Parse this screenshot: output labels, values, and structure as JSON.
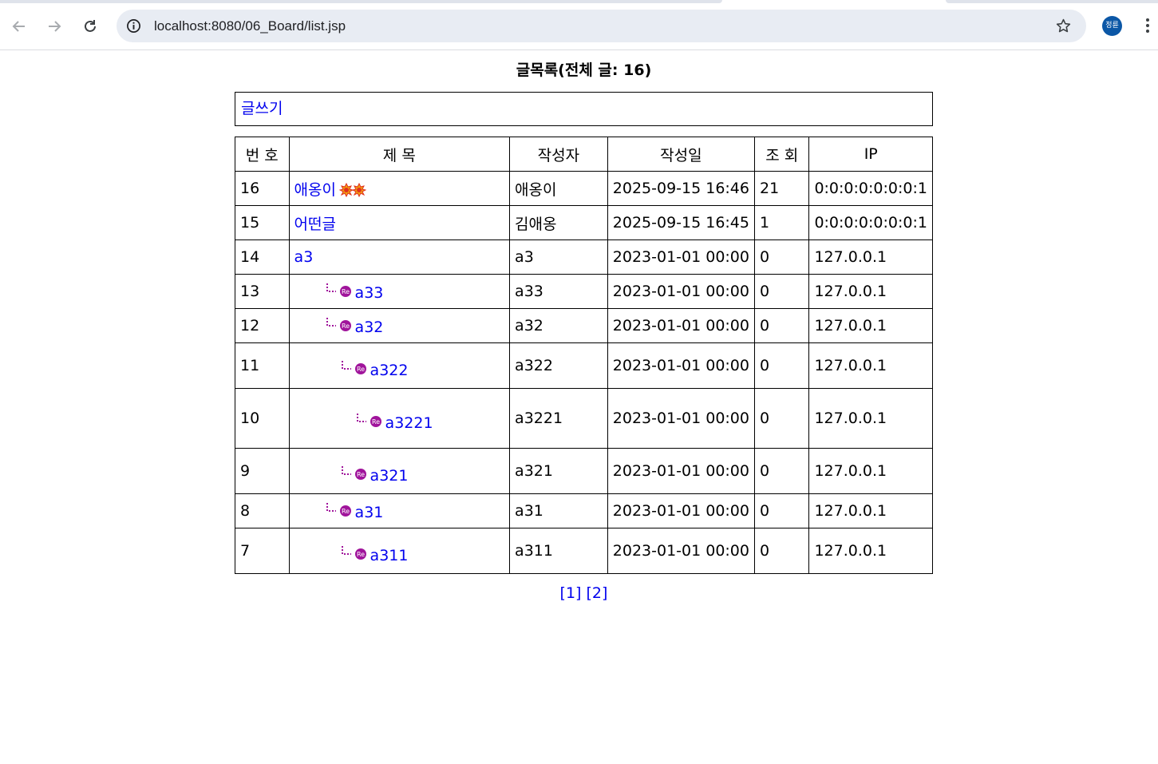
{
  "browser": {
    "url": "localhost:8080/06_Board/list.jsp",
    "profile_initials": "정륜"
  },
  "page": {
    "title": "글목록(전체 글: 16)",
    "write_link": "글쓰기"
  },
  "table": {
    "headers": [
      "번 호",
      "제 목",
      "작성자",
      "작성일",
      "조 회",
      "IP"
    ],
    "rows": [
      {
        "num": "16",
        "subject": "애옹이",
        "depth": 0,
        "hot": true,
        "writer": "애옹이",
        "date": "2025-09-15 16:46",
        "views": "21",
        "ip": "0:0:0:0:0:0:0:1"
      },
      {
        "num": "15",
        "subject": "어떤글",
        "depth": 0,
        "hot": false,
        "writer": "김애옹",
        "date": "2025-09-15 16:45",
        "views": "1",
        "ip": "0:0:0:0:0:0:0:1"
      },
      {
        "num": "14",
        "subject": "a3",
        "depth": 0,
        "hot": false,
        "writer": "a3",
        "date": "2023-01-01 00:00",
        "views": "0",
        "ip": "127.0.0.1"
      },
      {
        "num": "13",
        "subject": "a33",
        "depth": 1,
        "hot": false,
        "writer": "a33",
        "date": "2023-01-01 00:00",
        "views": "0",
        "ip": "127.0.0.1"
      },
      {
        "num": "12",
        "subject": "a32",
        "depth": 1,
        "hot": false,
        "writer": "a32",
        "date": "2023-01-01 00:00",
        "views": "0",
        "ip": "127.0.0.1"
      },
      {
        "num": "11",
        "subject": "a322",
        "depth": 2,
        "hot": false,
        "writer": "a322",
        "date": "2023-01-01 00:00",
        "views": "0",
        "ip": "127.0.0.1"
      },
      {
        "num": "10",
        "subject": "a3221",
        "depth": 3,
        "hot": false,
        "writer": "a3221",
        "date": "2023-01-01 00:00",
        "views": "0",
        "ip": "127.0.0.1"
      },
      {
        "num": "9",
        "subject": "a321",
        "depth": 2,
        "hot": false,
        "writer": "a321",
        "date": "2023-01-01 00:00",
        "views": "0",
        "ip": "127.0.0.1"
      },
      {
        "num": "8",
        "subject": "a31",
        "depth": 1,
        "hot": false,
        "writer": "a31",
        "date": "2023-01-01 00:00",
        "views": "0",
        "ip": "127.0.0.1"
      },
      {
        "num": "7",
        "subject": "a311",
        "depth": 2,
        "hot": false,
        "writer": "a311",
        "date": "2023-01-01 00:00",
        "views": "0",
        "ip": "127.0.0.1"
      }
    ]
  },
  "pagination": {
    "pages": [
      "[1]",
      "[2]"
    ]
  },
  "icons": {
    "reply": "reply-re-icon",
    "hot": "hot-badge-icon"
  },
  "colors": {
    "link": "#0000ee",
    "reply_icon": "#a0149b",
    "avatar": "#0b57a6"
  }
}
